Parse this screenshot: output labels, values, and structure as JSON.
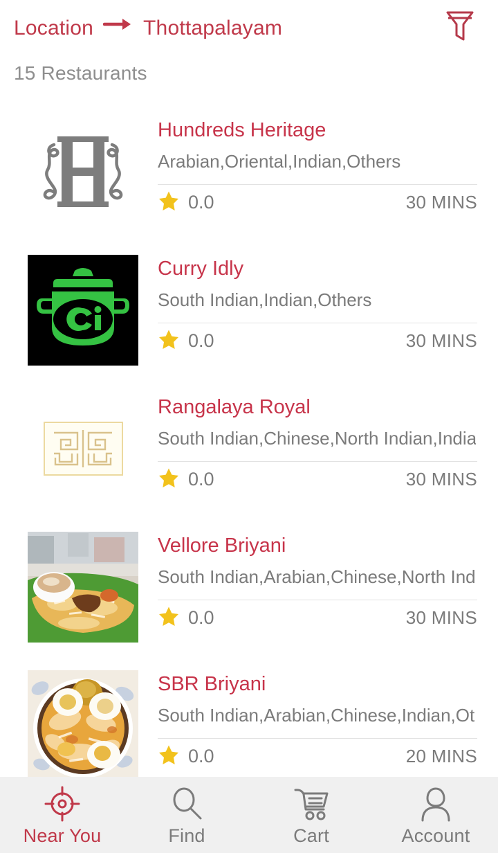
{
  "header": {
    "location_label": "Location",
    "location_value": "Thottapalayam",
    "arrow_icon": "arrow-right-icon",
    "filter_icon": "filter-funnel-icon",
    "accent_color": "#c0394a"
  },
  "count": {
    "text": "15 Restaurants"
  },
  "restaurants": [
    {
      "name": "Hundreds Heritage",
      "cuisines": "Arabian,Oriental,Indian,Others",
      "rating": "0.0",
      "delivery_time": "30 MINS",
      "logo_type": "letter-h-monogram",
      "logo_colors": [
        "#7a7a7a",
        "#ffffff"
      ]
    },
    {
      "name": "Curry Idly",
      "cuisines": "South Indian,Indian,Others",
      "rating": "0.0",
      "delivery_time": "30 MINS",
      "logo_type": "green-pot-ci",
      "logo_colors": [
        "#000000",
        "#35c243"
      ]
    },
    {
      "name": "Rangalaya Royal",
      "cuisines": "South Indian,Chinese,North Indian,India…",
      "rating": "0.0",
      "delivery_time": "30 MINS",
      "logo_type": "greek-key-meander",
      "logo_colors": [
        "#fffdf2",
        "#e3cf9c"
      ]
    },
    {
      "name": "Vellore Briyani",
      "cuisines": "South Indian,Arabian,Chinese,North Ind…",
      "rating": "0.0",
      "delivery_time": "30 MINS",
      "logo_type": "biryani-banana-leaf-photo",
      "logo_colors": [
        "#e8b64a",
        "#3f7d2e"
      ]
    },
    {
      "name": "SBR Briyani",
      "cuisines": "South Indian,Arabian,Chinese,Indian,Ot…",
      "rating": "0.0",
      "delivery_time": "20 MINS",
      "logo_type": "biryani-egg-bowl-photo",
      "logo_colors": [
        "#e7a33c",
        "#f2eadf"
      ]
    }
  ],
  "star": {
    "icon": "star-icon",
    "color": "#f2c21c"
  },
  "bottom_nav": [
    {
      "label": "Near You",
      "icon": "target-crosshair-icon",
      "active": true
    },
    {
      "label": "Find",
      "icon": "search-magnifier-icon",
      "active": false
    },
    {
      "label": "Cart",
      "icon": "shopping-cart-icon",
      "active": false
    },
    {
      "label": "Account",
      "icon": "person-account-icon",
      "active": false
    }
  ]
}
